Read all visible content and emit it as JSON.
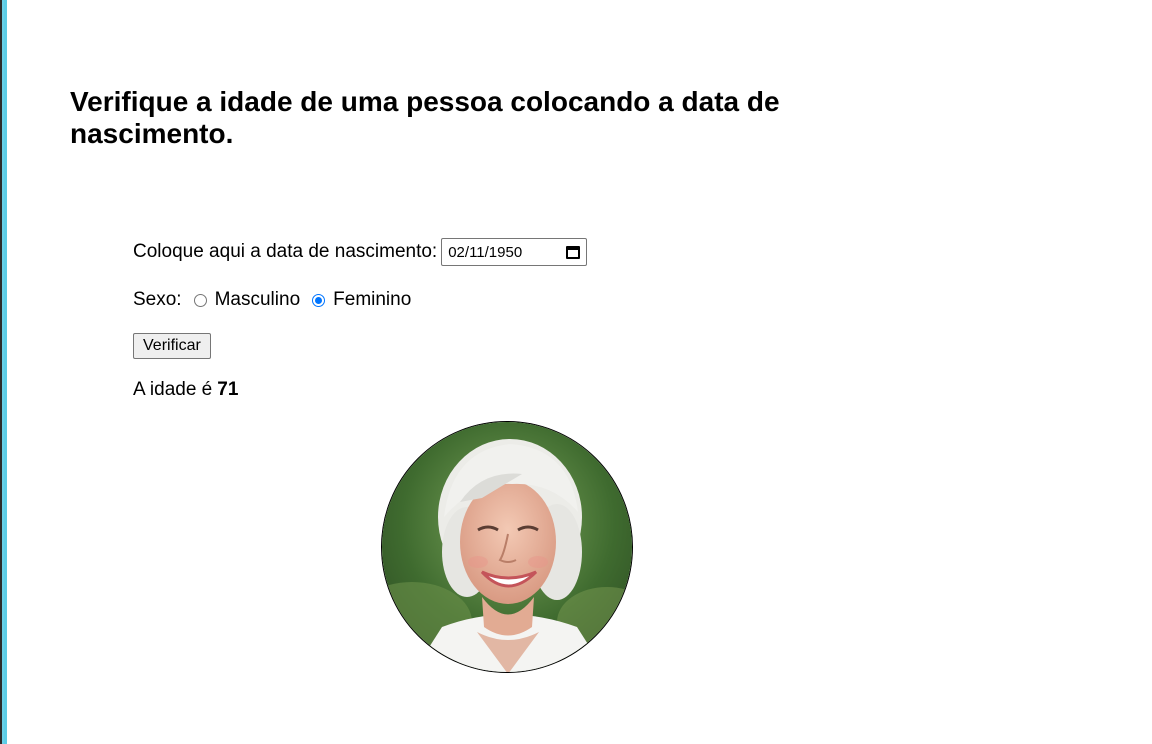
{
  "heading": {
    "title": "Verifique a idade de uma pessoa colocando a data de nascimento."
  },
  "form": {
    "date_label": "Coloque aqui a data de nascimento:",
    "date_value": "02/11/1950",
    "sex_label": "Sexo:",
    "sex_options": [
      {
        "label": "Masculino",
        "checked": false
      },
      {
        "label": "Feminino",
        "checked": true
      }
    ],
    "submit_label": "Verificar"
  },
  "result": {
    "label": "A idade é",
    "age": "71"
  },
  "image": {
    "icon": "elderly-woman-photo",
    "colors": {
      "radio_accent": "#0075ff",
      "frame_accent": "#5ccde6"
    }
  }
}
